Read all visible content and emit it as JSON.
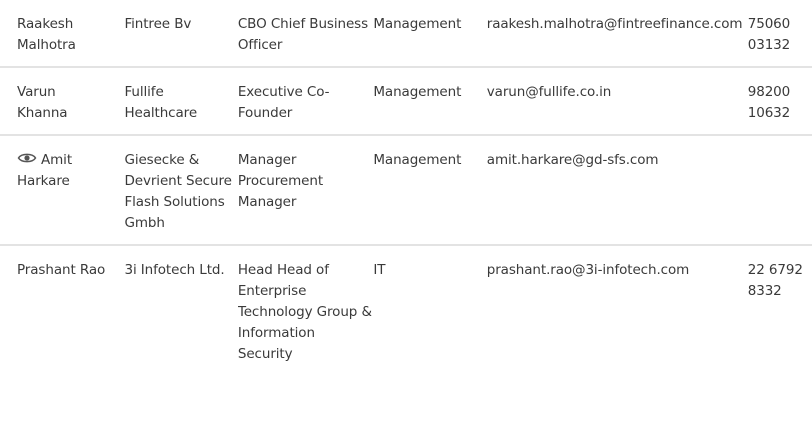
{
  "rows": [
    {
      "name_line1": "Raakesh",
      "name_line2": "Malhotra",
      "company": "Fintree Bv",
      "title": "CBO Chief Business Officer",
      "department": "Management",
      "email": "raakesh.malhotra@fintreefinance.com",
      "phone_line1": "75060",
      "phone_line2": "03132"
    },
    {
      "name_line1": "Varun",
      "name_line2": "Khanna",
      "company": "Fullife Healthcare",
      "title": "Executive Co-Founder",
      "department": "Management",
      "email": "varun@fullife.co.in",
      "phone_line1": "98200",
      "phone_line2": "10632"
    },
    {
      "name_line1": "Amit",
      "name_line2": "Harkare",
      "icon": "eye-icon",
      "company": "Giesecke & Devrient Secure Flash Solutions Gmbh",
      "title": "Manager Procurement Manager",
      "department": "Management",
      "email": "amit.harkare@gd-sfs.com",
      "phone_line1": "",
      "phone_line2": ""
    },
    {
      "name_line1": "Prashant Rao",
      "name_line2": "",
      "company": "3i Infotech Ltd.",
      "title": "Head Head of Enterprise Technology Group & Information Security",
      "department": "IT",
      "email": "prashant.rao@3i-infotech.com",
      "phone_line1": "22 6792",
      "phone_line2": "8332"
    }
  ]
}
